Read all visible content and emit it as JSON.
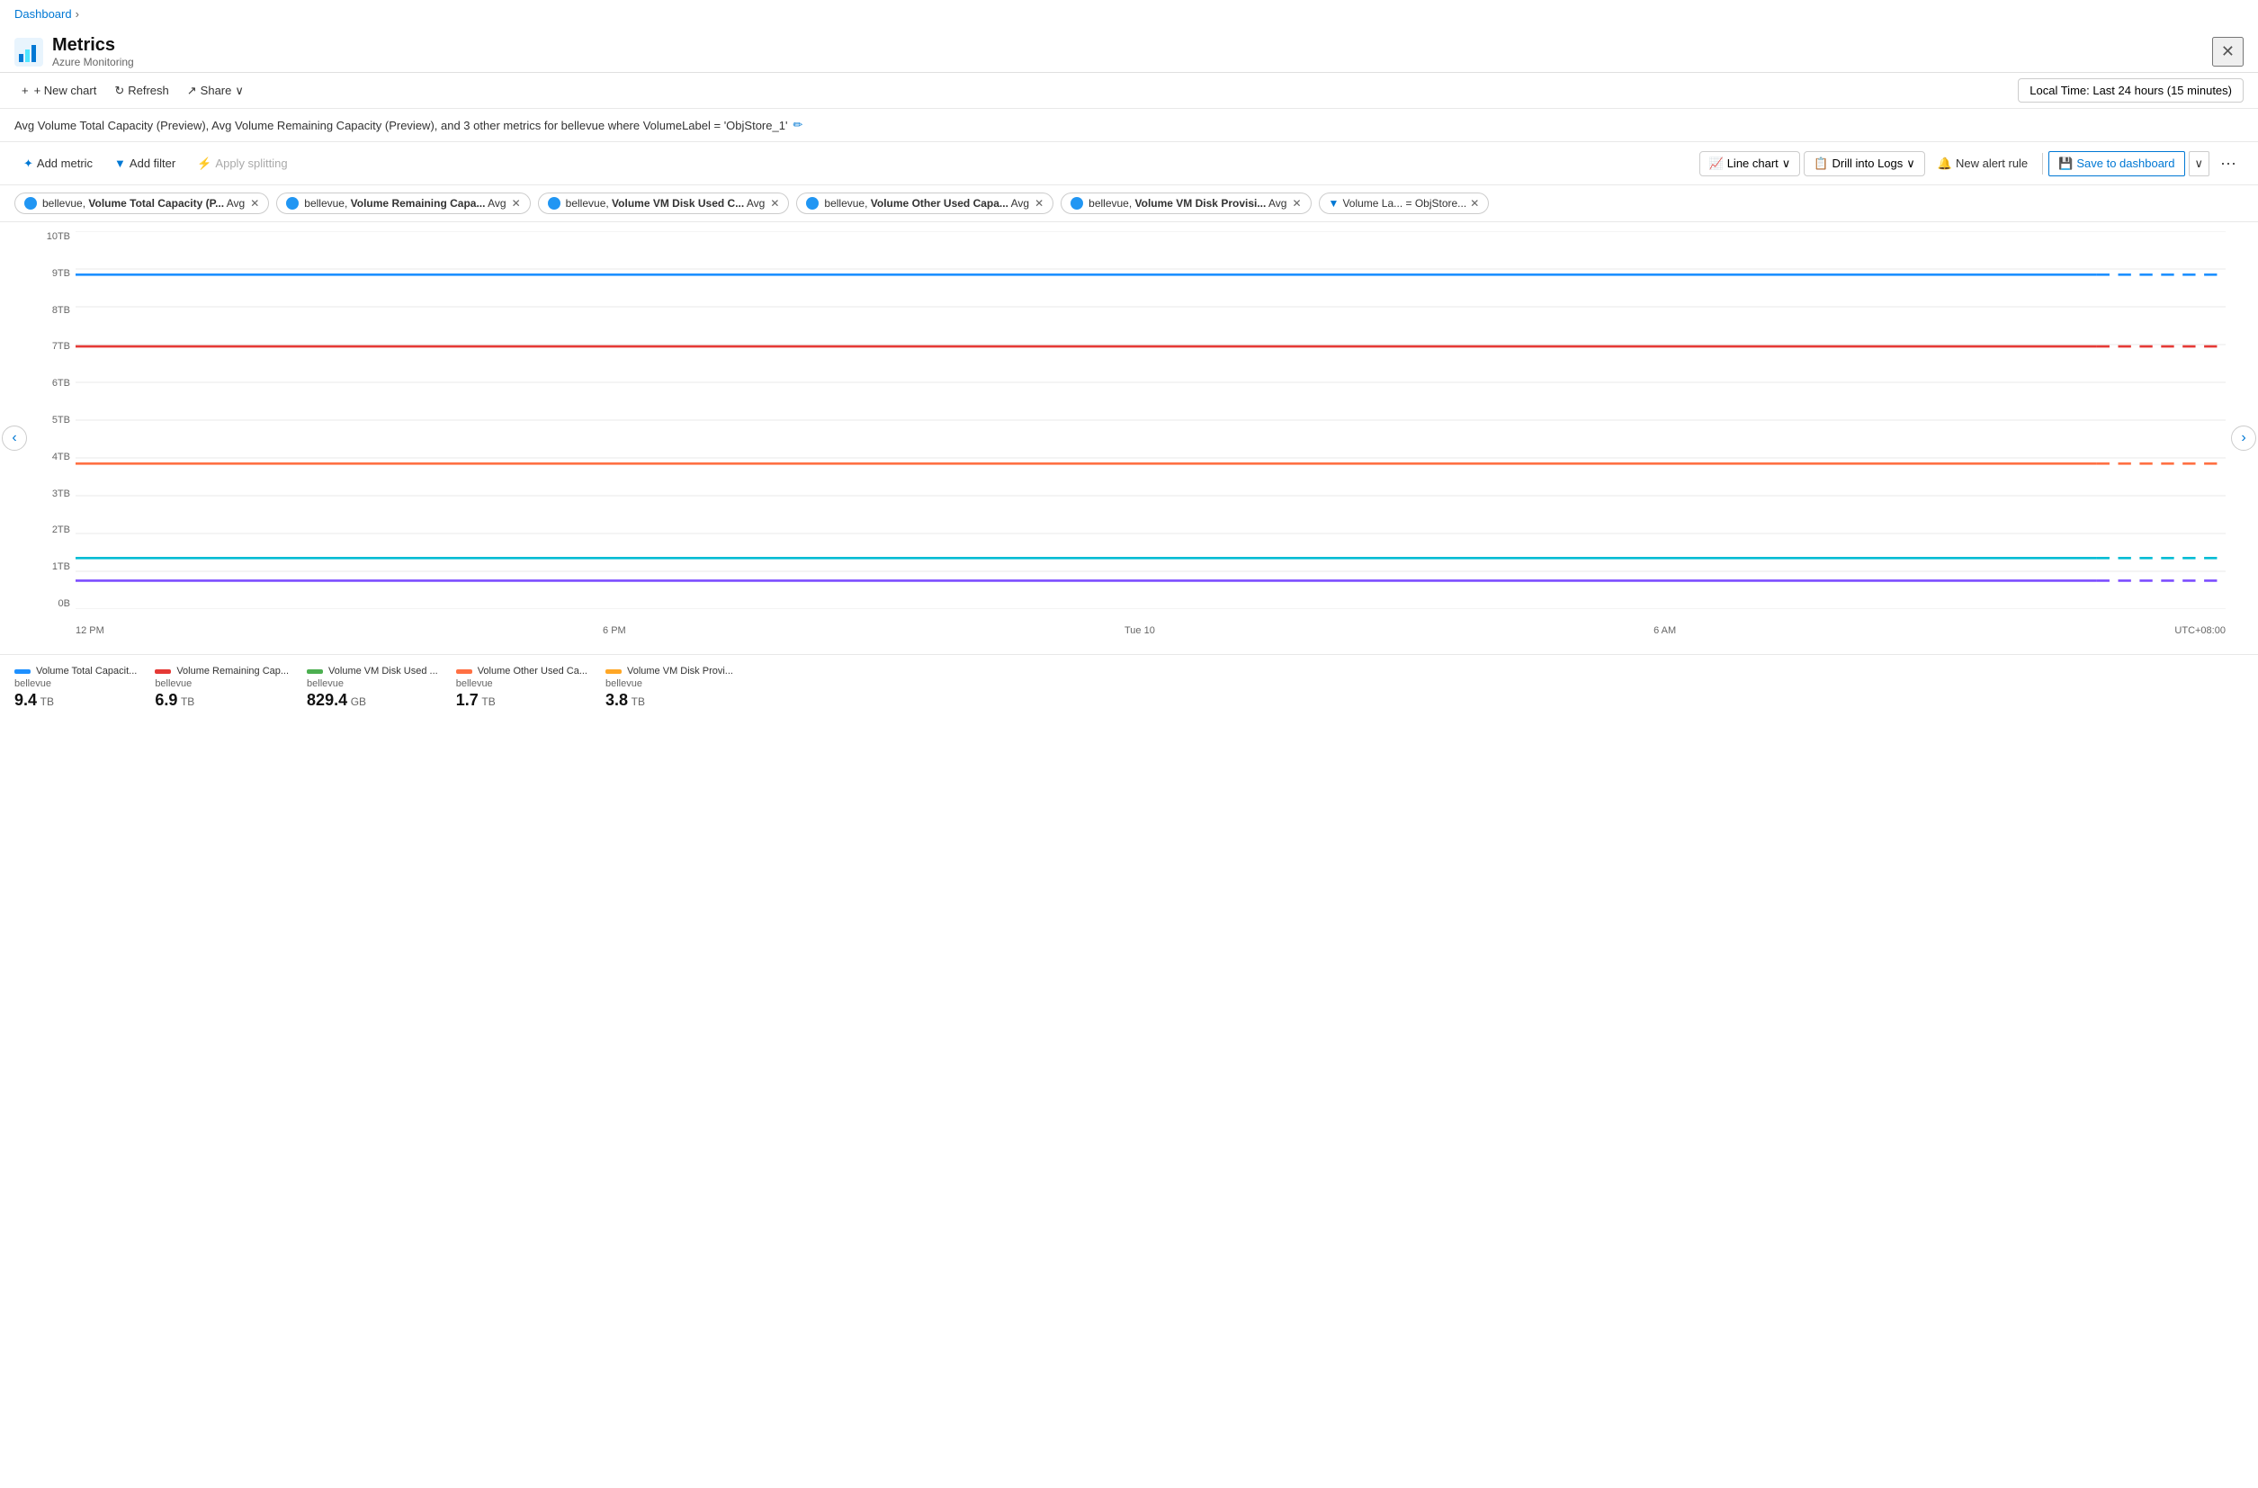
{
  "breadcrumb": {
    "items": [
      {
        "label": "Dashboard",
        "active": true
      }
    ],
    "chevron": "›"
  },
  "header": {
    "title": "Metrics",
    "subtitle": "Azure Monitoring",
    "close_label": "✕"
  },
  "toolbar": {
    "new_chart_label": "+ New chart",
    "refresh_label": "Refresh",
    "share_label": "Share",
    "share_chevron": "∨",
    "time_picker_label": "Local Time: Last 24 hours (15 minutes)"
  },
  "chart_header": {
    "title": "Avg Volume Total Capacity (Preview), Avg Volume Remaining Capacity (Preview), and 3 other metrics for bellevue where VolumeLabel = 'ObjStore_1'",
    "edit_icon": "✏"
  },
  "metrics_toolbar": {
    "add_metric_label": "Add metric",
    "add_filter_label": "Add filter",
    "apply_splitting_label": "Apply splitting",
    "line_chart_label": "Line chart",
    "drill_into_logs_label": "Drill into Logs",
    "new_alert_rule_label": "New alert rule",
    "save_to_dashboard_label": "Save to dashboard",
    "expand_label": "∨",
    "more_label": "···"
  },
  "tags": [
    {
      "id": "t1",
      "color": "#2196f3",
      "text": "bellevue, ",
      "bold": "Volume Total Capacity (P...",
      "suffix": " Avg",
      "hasClose": true
    },
    {
      "id": "t2",
      "color": "#2196f3",
      "text": "bellevue, ",
      "bold": "Volume Remaining Capa...",
      "suffix": " Avg",
      "hasClose": true
    },
    {
      "id": "t3",
      "color": "#2196f3",
      "text": "bellevue, ",
      "bold": "Volume VM Disk Used C...",
      "suffix": " Avg",
      "hasClose": true
    },
    {
      "id": "t4",
      "color": "#2196f3",
      "text": "bellevue, ",
      "bold": "Volume Other Used Capa...",
      "suffix": " Avg",
      "hasClose": true
    },
    {
      "id": "t5",
      "color": "#2196f3",
      "text": "bellevue, ",
      "bold": "Volume VM Disk Provisi...",
      "suffix": " Avg",
      "hasClose": true
    },
    {
      "id": "t6",
      "color": null,
      "text": "Volume La... = ObjStore...",
      "bold": "",
      "suffix": "",
      "hasClose": true,
      "isFilter": true
    }
  ],
  "chart": {
    "y_labels": [
      "10TB",
      "9TB",
      "8TB",
      "7TB",
      "6TB",
      "5TB",
      "4TB",
      "3TB",
      "2TB",
      "1TB",
      "0B"
    ],
    "x_labels": [
      "12 PM",
      "6 PM",
      "Tue 10",
      "6 AM",
      "UTC+08:00"
    ],
    "lines": [
      {
        "id": "l1",
        "color": "#1e90ff",
        "y_pct": 88,
        "label": "Volume Total Capacity (blue)"
      },
      {
        "id": "l2",
        "color": "#e53935",
        "y_pct": 68,
        "label": "Volume Remaining Capacity (red)"
      },
      {
        "id": "l3",
        "color": "#ff7043",
        "y_pct": 39,
        "label": "Volume Other Used Capacity (orange)"
      },
      {
        "id": "l4",
        "color": "#00bcd4",
        "y_pct": 14,
        "label": "Volume VM Disk Used (cyan)"
      },
      {
        "id": "l5",
        "color": "#7c4dff",
        "y_pct": 8,
        "label": "Volume VM Disk Provisioned (purple)"
      }
    ]
  },
  "legend": [
    {
      "id": "leg1",
      "color": "#1e90ff",
      "name": "Volume Total Capacit...",
      "sub": "bellevue",
      "value": "9.4",
      "unit": "TB"
    },
    {
      "id": "leg2",
      "color": "#e53935",
      "name": "Volume Remaining Cap...",
      "sub": "bellevue",
      "value": "6.9",
      "unit": "TB"
    },
    {
      "id": "leg3",
      "color": "#4caf50",
      "name": "Volume VM Disk Used ...",
      "sub": "bellevue",
      "value": "829.4",
      "unit": "GB"
    },
    {
      "id": "leg4",
      "color": "#ff7043",
      "name": "Volume Other Used Ca...",
      "sub": "bellevue",
      "value": "1.7",
      "unit": "TB"
    },
    {
      "id": "leg5",
      "color": "#ffa726",
      "name": "Volume VM Disk Provi...",
      "sub": "bellevue",
      "value": "3.8",
      "unit": "TB"
    }
  ]
}
